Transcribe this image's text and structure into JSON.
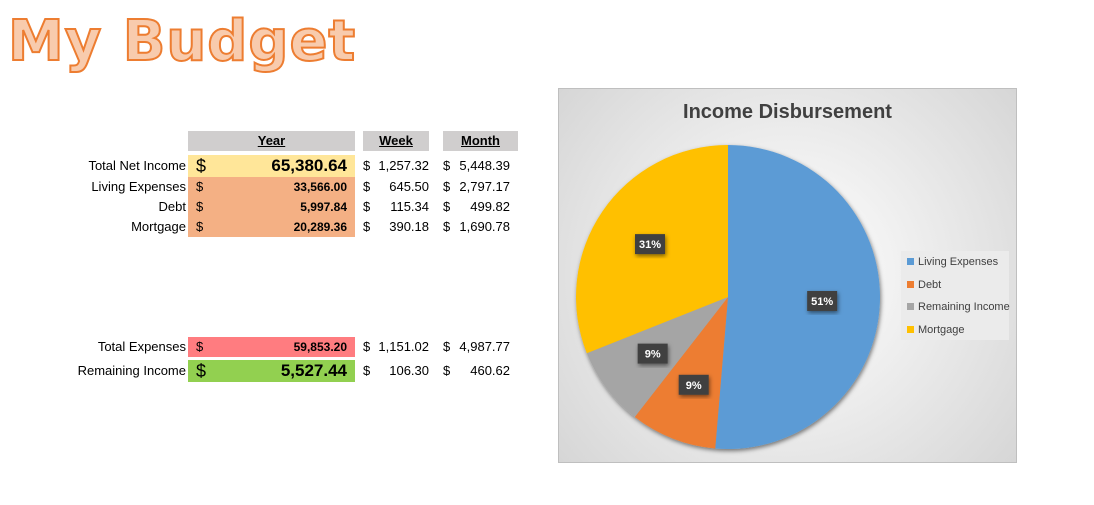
{
  "title": "My Budget",
  "table": {
    "headers": {
      "year": "Year",
      "week": "Week",
      "month": "Month"
    },
    "rows": [
      {
        "label": "Total Net Income",
        "year": "65,380.64",
        "week": "1,257.32",
        "month": "5,448.39",
        "color": "#ffe699"
      },
      {
        "label": "Living Expenses",
        "year": "33,566.00",
        "week": "645.50",
        "month": "2,797.17",
        "color": "#f4b084"
      },
      {
        "label": "Debt",
        "year": "5,997.84",
        "week": "115.34",
        "month": "499.82",
        "color": "#f4b084"
      },
      {
        "label": "Mortgage",
        "year": "20,289.36",
        "week": "390.18",
        "month": "1,690.78",
        "color": "#f4b084"
      },
      {
        "label": "Total Expenses",
        "year": "59,853.20",
        "week": "1,151.02",
        "month": "4,987.77",
        "color": "#ff7c80"
      },
      {
        "label": "Remaining Income",
        "year": "5,527.44",
        "week": "106.30",
        "month": "460.62",
        "color": "#92d050"
      }
    ],
    "currency": "$"
  },
  "chart_data": {
    "type": "pie",
    "title": "Income Disbursement",
    "categories": [
      "Living Expenses",
      "Debt",
      "Remaining Income",
      "Mortgage"
    ],
    "values": [
      33566.0,
      5997.84,
      5527.44,
      20289.36
    ],
    "data_labels": [
      "51%",
      "9%",
      "9%",
      "31%"
    ],
    "colors": [
      "#5b9bd5",
      "#ed7d31",
      "#a5a5a5",
      "#ffc000"
    ],
    "legend": "right"
  }
}
